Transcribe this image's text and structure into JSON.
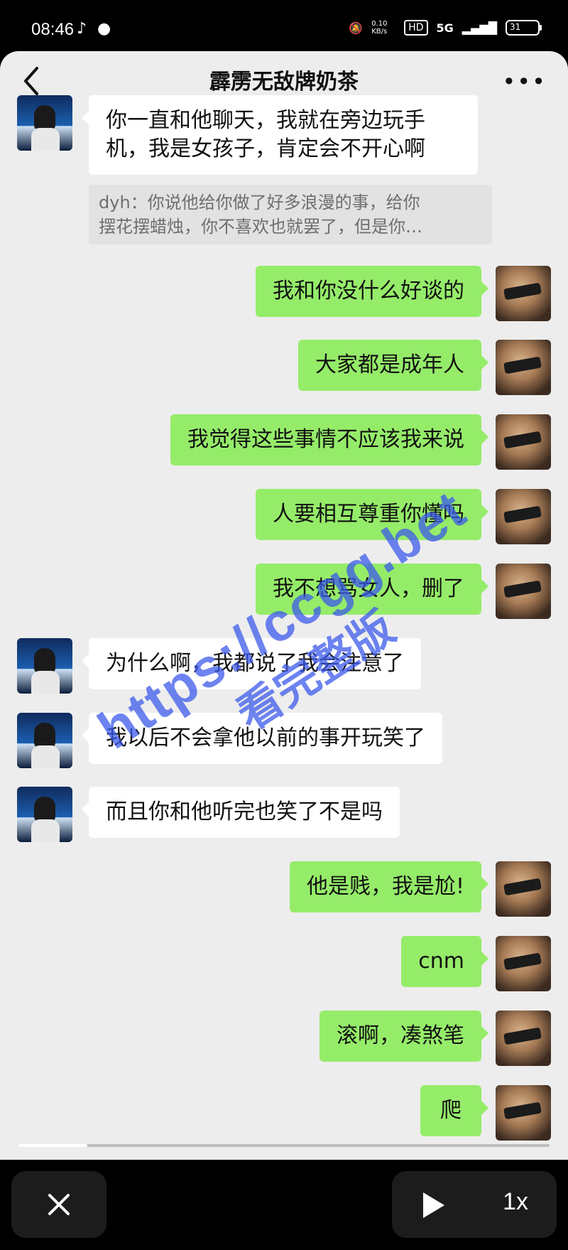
{
  "status_bar": {
    "time": "08:46",
    "app_icons": [
      "tiktok-icon",
      "qq-icon"
    ],
    "net_speed": "0.10 KB/s",
    "hd": "HD",
    "network": "5G",
    "battery": "31"
  },
  "header": {
    "title": "霹雳无敌牌奶茶",
    "back_icon": "chevron-left-icon",
    "more_icon": "more-dots-icon"
  },
  "messages": [
    {
      "side": "other",
      "lines": [
        "你一直和他聊天，我就在旁边玩手",
        "机，我是女孩子，肯定会不开心啊"
      ]
    },
    {
      "side": "self",
      "text": "我和你没什么好谈的"
    },
    {
      "side": "self",
      "text": "大家都是成年人"
    },
    {
      "side": "self",
      "text": "我觉得这些事情不应该我来说"
    },
    {
      "side": "self",
      "text": "人要相互尊重你懂吗"
    },
    {
      "side": "self",
      "text": "我不想骂女人，删了"
    },
    {
      "side": "other",
      "text": "为什么啊，我都说了我会注意了"
    },
    {
      "side": "other",
      "text": "我以后不会拿他以前的事开玩笑了"
    },
    {
      "side": "other",
      "text": "而且你和他听完也笑了不是吗"
    },
    {
      "side": "self",
      "text": "他是贱，我是尬!"
    },
    {
      "side": "self",
      "text": "cnm"
    },
    {
      "side": "self",
      "text": "滚啊，凑煞笔"
    },
    {
      "side": "self",
      "text": "爬"
    }
  ],
  "quote": {
    "line1": "dyh：你说他给你做了好多浪漫的事，给你",
    "line2": "摆花摆蜡烛，你不喜欢也就罢了，但是你…"
  },
  "watermark": {
    "url": "https://ccgg.bet",
    "cn": "看完整版"
  },
  "player": {
    "progress": 0.13,
    "close_icon": "close-icon",
    "play_icon": "play-icon",
    "speed": "1x"
  }
}
